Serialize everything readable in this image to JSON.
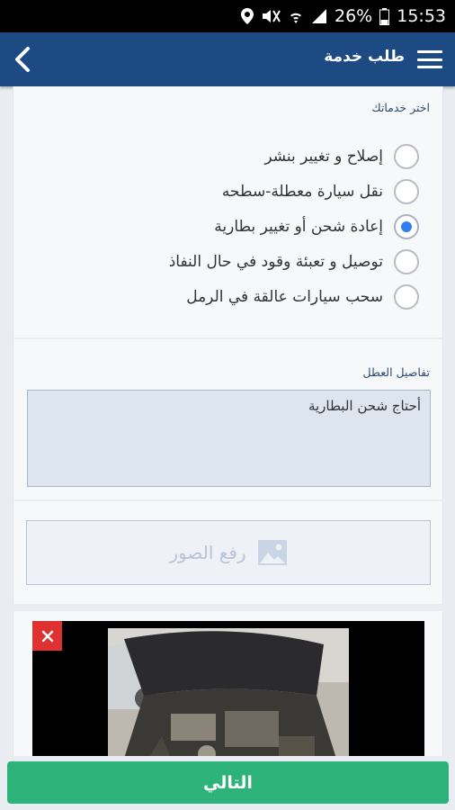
{
  "status_bar": {
    "battery": "26%",
    "time": "15:53"
  },
  "header": {
    "title": "طلب خدمة"
  },
  "service_section": {
    "label": "اختر خدماتك",
    "options": [
      {
        "label": "إصلاح و تغيير بنشر",
        "checked": false
      },
      {
        "label": "نقل سيارة معطلة-سطحه",
        "checked": false
      },
      {
        "label": "إعادة شحن أو تغيير بطارية",
        "checked": true
      },
      {
        "label": "توصيل و تعبئة وقود في حال النفاذ",
        "checked": false
      },
      {
        "label": "سحب سيارات عالقة في الرمل",
        "checked": false
      }
    ]
  },
  "details_section": {
    "label": "تفاصيل العطل",
    "value": "أحتاج  شحن البطارية"
  },
  "upload": {
    "label": "رفع الصور"
  },
  "footer": {
    "next_label": "التالي"
  },
  "colors": {
    "app_bar": "#1e4a84",
    "accent": "#2f80ed",
    "next_button": "#2db37a",
    "remove_button": "#e03131"
  }
}
